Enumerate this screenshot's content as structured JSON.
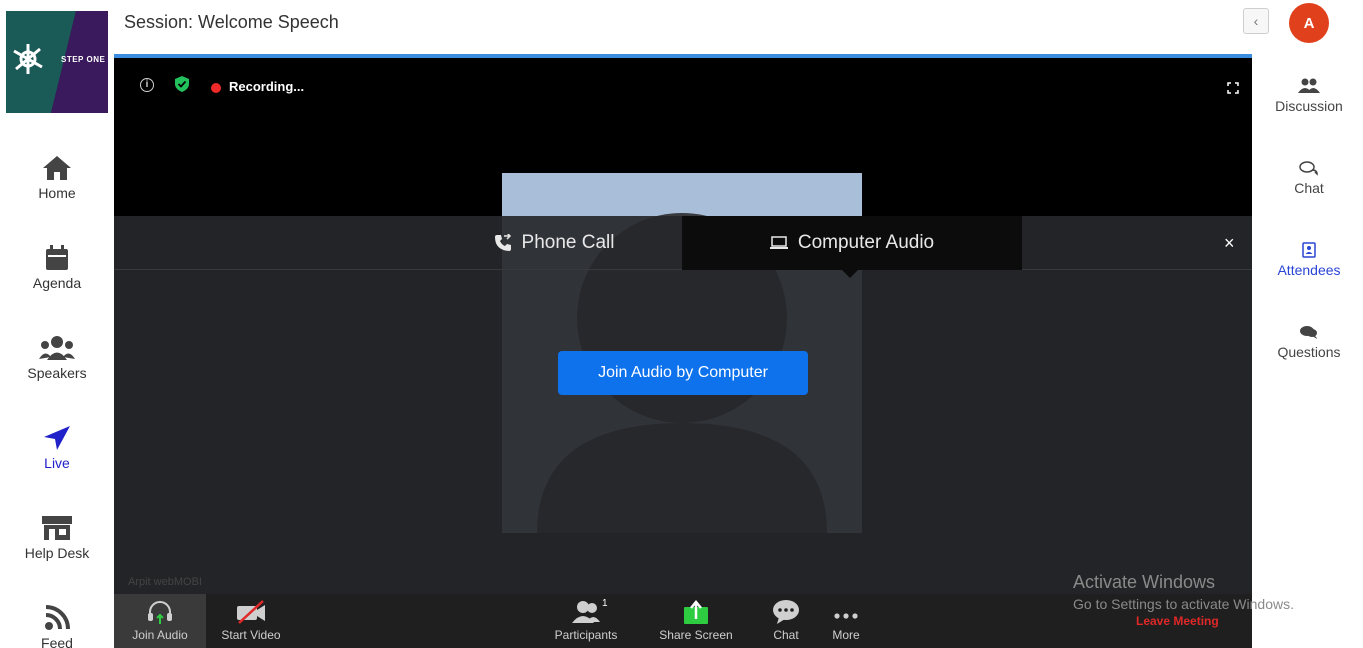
{
  "header": {
    "session_title": "Session: Welcome Speech"
  },
  "logo": {
    "text": "STEP ONE"
  },
  "user": {
    "avatar_initial": "A"
  },
  "sidebar": {
    "items": [
      {
        "label": "Home",
        "icon": "home-icon"
      },
      {
        "label": "Agenda",
        "icon": "calendar-icon"
      },
      {
        "label": "Speakers",
        "icon": "users-icon"
      },
      {
        "label": "Live",
        "icon": "location-arrow-icon",
        "active": true
      },
      {
        "label": "Help Desk",
        "icon": "store-icon"
      },
      {
        "label": "Feed",
        "icon": "rss-icon"
      }
    ]
  },
  "right_panel": {
    "items": [
      {
        "label": "Discussion",
        "icon": "user-group-icon"
      },
      {
        "label": "Chat",
        "icon": "chat-bubbles-icon"
      },
      {
        "label": "Attendees",
        "icon": "address-book-icon",
        "active": true
      },
      {
        "label": "Questions",
        "icon": "comments-icon"
      }
    ]
  },
  "meeting": {
    "recording_label": "Recording...",
    "watermark_name": "Arpit webMOBI",
    "audio_dialog": {
      "tabs": [
        {
          "label": "Phone Call",
          "icon": "phone-icon"
        },
        {
          "label": "Computer Audio",
          "icon": "laptop-icon",
          "active": true
        }
      ],
      "join_button": "Join Audio by Computer",
      "close_label": "×"
    },
    "toolbar": {
      "join_audio": "Join Audio",
      "start_video": "Start Video",
      "participants": "Participants",
      "participants_count": "1",
      "share_screen": "Share Screen",
      "chat": "Chat",
      "more": "More",
      "leave": "Leave Meeting"
    }
  },
  "system_overlay": {
    "line1": "Activate Windows",
    "line2": "Go to Settings to activate Windows."
  },
  "colors": {
    "accent_blue": "#0e72ed",
    "meeting_border": "#3a8de0",
    "avatar": "#e0401b",
    "active_nav": "#2121c9",
    "leave": "#e02828",
    "share_green": "#2ecc40"
  }
}
